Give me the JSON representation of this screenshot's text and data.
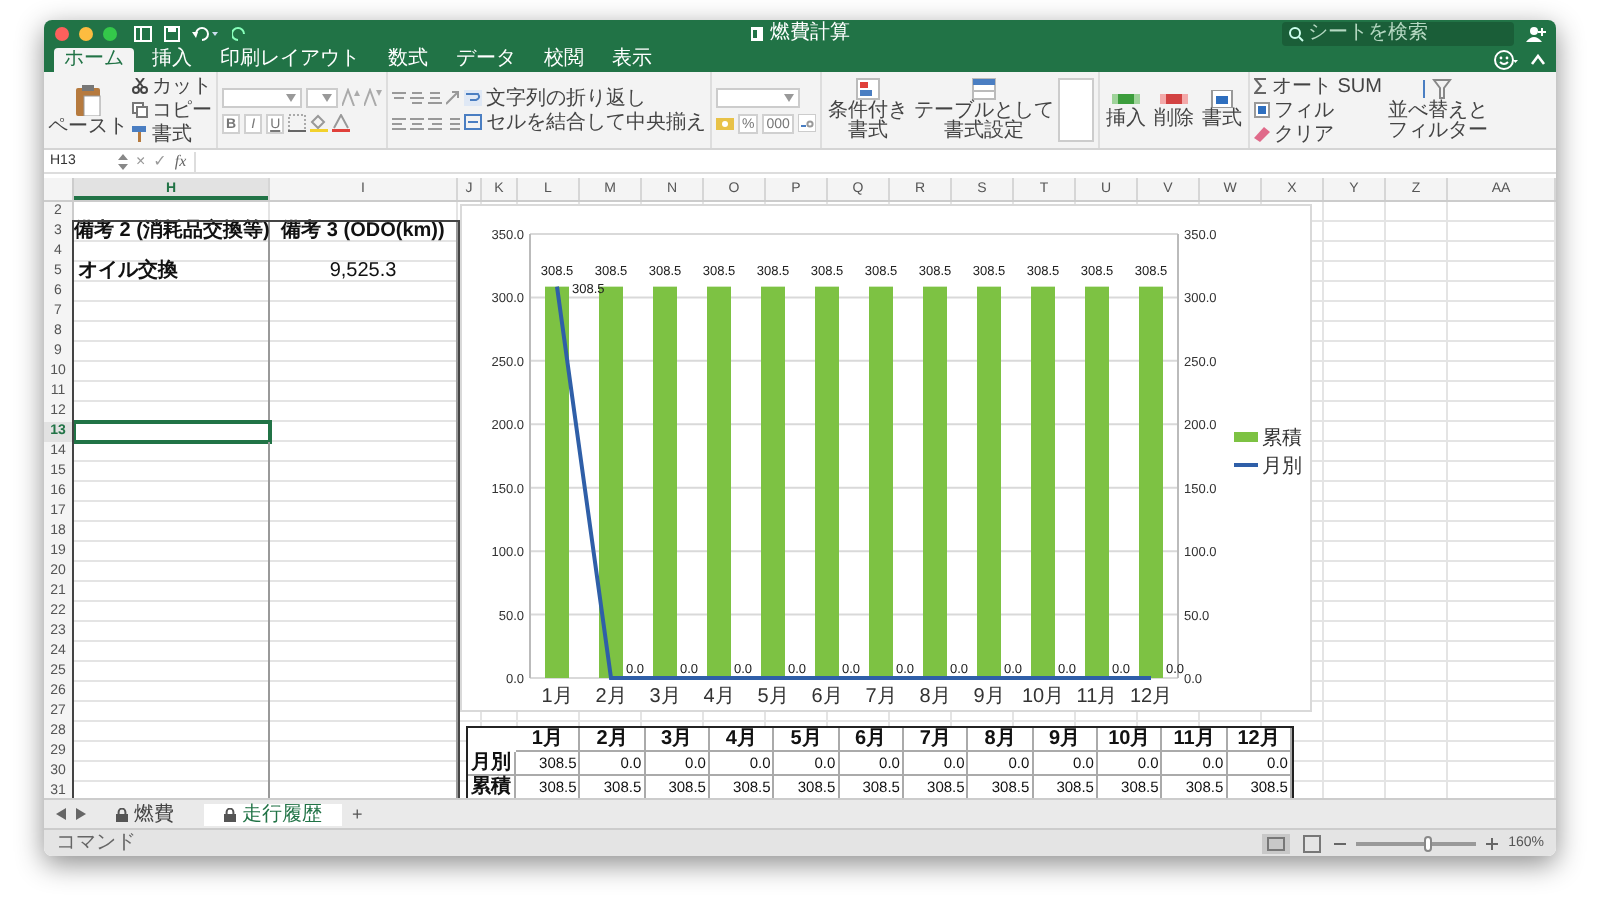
{
  "window": {
    "title": "燃費計算",
    "search": {
      "placeholder": "シートを検索"
    }
  },
  "ribbon": {
    "tabs": [
      {
        "label": "ホーム",
        "selected": true
      },
      {
        "label": "挿入",
        "selected": false
      },
      {
        "label": "印刷レイアウト",
        "selected": false
      },
      {
        "label": "数式",
        "selected": false
      },
      {
        "label": "データ",
        "selected": false
      },
      {
        "label": "校閲",
        "selected": false
      },
      {
        "label": "表示",
        "selected": false
      }
    ],
    "clipboard": {
      "paste": "ペースト",
      "cut": "カット",
      "copy": "コピー",
      "format_painter": "書式"
    },
    "font": {
      "bold": "B",
      "italic": "I",
      "underline": "U"
    },
    "alignment": {
      "wrap_text": "文字列の折り返し",
      "merge_center": "セルを結合して中央揃え"
    },
    "number": {
      "percent": "%",
      "thousands": "000"
    },
    "styles": {
      "conditional": "条件付き書式",
      "table": "テーブルとして書式設定"
    },
    "cells": {
      "insert": "挿入",
      "delete": "削除",
      "format": "書式"
    },
    "editing": {
      "autosum": "オート SUM",
      "fill": "フィル",
      "clear": "クリア",
      "sort_filter": "並べ替えとフィルター"
    }
  },
  "formula_bar": {
    "name_box": "H13",
    "cancel": "×",
    "enter": "✓",
    "function": "fx"
  },
  "sheet": {
    "columns": [
      {
        "label": "H",
        "selected": true
      },
      {
        "label": "I",
        "selected": false
      },
      {
        "label": "J",
        "selected": false
      },
      {
        "label": "K",
        "selected": false
      },
      {
        "label": "L",
        "selected": false
      },
      {
        "label": "M",
        "selected": false
      },
      {
        "label": "N",
        "selected": false
      },
      {
        "label": "O",
        "selected": false
      },
      {
        "label": "P",
        "selected": false
      },
      {
        "label": "Q",
        "selected": false
      },
      {
        "label": "R",
        "selected": false
      },
      {
        "label": "S",
        "selected": false
      },
      {
        "label": "T",
        "selected": false
      },
      {
        "label": "U",
        "selected": false
      },
      {
        "label": "V",
        "selected": false
      },
      {
        "label": "W",
        "selected": false
      },
      {
        "label": "X",
        "selected": false
      },
      {
        "label": "Y",
        "selected": false
      },
      {
        "label": "Z",
        "selected": false
      },
      {
        "label": "AA",
        "selected": false
      }
    ],
    "rows": [
      {
        "number": "2",
        "selected": false
      },
      {
        "number": "3",
        "selected": false,
        "cells": [
          {
            "text": "備考 2 (消耗品交換等)",
            "bold": true,
            "centered": true
          },
          {
            "text": "備考 3 (ODO(km))",
            "bold": true,
            "centered": true
          }
        ]
      },
      {
        "number": "4",
        "selected": false
      },
      {
        "number": "5",
        "selected": false,
        "cells": [
          {
            "text": "オイル交換",
            "bold": true,
            "centered": false
          },
          {
            "text": "9,525.3",
            "bold": false,
            "centered": true
          }
        ]
      },
      {
        "number": "6",
        "selected": false
      },
      {
        "number": "7",
        "selected": false
      },
      {
        "number": "8",
        "selected": false
      },
      {
        "number": "9",
        "selected": false
      },
      {
        "number": "10",
        "selected": false
      },
      {
        "number": "11",
        "selected": false
      },
      {
        "number": "12",
        "selected": false
      },
      {
        "number": "13",
        "selected": true
      },
      {
        "number": "14",
        "selected": false
      },
      {
        "number": "15",
        "selected": false
      },
      {
        "number": "16",
        "selected": false
      },
      {
        "number": "17",
        "selected": false
      },
      {
        "number": "18",
        "selected": false
      },
      {
        "number": "19",
        "selected": false
      },
      {
        "number": "20",
        "selected": false
      },
      {
        "number": "21",
        "selected": false
      },
      {
        "number": "22",
        "selected": false
      },
      {
        "number": "23",
        "selected": false
      },
      {
        "number": "24",
        "selected": false
      },
      {
        "number": "25",
        "selected": false
      },
      {
        "number": "26",
        "selected": false
      },
      {
        "number": "27",
        "selected": false
      },
      {
        "number": "28",
        "selected": false
      },
      {
        "number": "29",
        "selected": false
      },
      {
        "number": "30",
        "selected": false
      },
      {
        "number": "31",
        "selected": false
      }
    ]
  },
  "chart": {
    "chart_data": {
      "type": "bar",
      "categories": [
        "1月",
        "2月",
        "3月",
        "4月",
        "5月",
        "6月",
        "7月",
        "8月",
        "9月",
        "10月",
        "11月",
        "12月"
      ],
      "series": [
        {
          "name": "累積",
          "type": "bar",
          "color": "#7dc243",
          "values": [
            308.5,
            308.5,
            308.5,
            308.5,
            308.5,
            308.5,
            308.5,
            308.5,
            308.5,
            308.5,
            308.5,
            308.5
          ]
        },
        {
          "name": "月別",
          "type": "line",
          "color": "#2f5fa8",
          "values": [
            308.5,
            0,
            0,
            0,
            0,
            0,
            0,
            0,
            0,
            0,
            0,
            0
          ]
        }
      ],
      "ylim": [
        0,
        350
      ],
      "yticks": [
        {
          "value": 0,
          "label": "0.0"
        },
        {
          "value": 50,
          "label": "50.0"
        },
        {
          "value": 100,
          "label": "100.0"
        },
        {
          "value": 150,
          "label": "150.0"
        },
        {
          "value": 200,
          "label": "200.0"
        },
        {
          "value": 250,
          "label": "250.0"
        },
        {
          "value": 300,
          "label": "300.0"
        },
        {
          "value": 350,
          "label": "350.0"
        }
      ],
      "y2lim": [
        0,
        350
      ],
      "y2ticks": [
        {
          "value": 0,
          "label": "0.0"
        },
        {
          "value": 50,
          "label": "50.0"
        },
        {
          "value": 100,
          "label": "100.0"
        },
        {
          "value": 150,
          "label": "150.0"
        },
        {
          "value": 200,
          "label": "200.0"
        },
        {
          "value": 250,
          "label": "250.0"
        },
        {
          "value": 300,
          "label": "300.0"
        },
        {
          "value": 350,
          "label": "350.0"
        }
      ],
      "grid": true,
      "legend": "right",
      "value_labels": [
        [
          "308.5",
          "308.5",
          "308.5",
          "308.5",
          "308.5",
          "308.5",
          "308.5",
          "308.5",
          "308.5",
          "308.5",
          "308.5",
          "308.5"
        ],
        [
          "308.5",
          "0.0",
          "0.0",
          "0.0",
          "0.0",
          "0.0",
          "0.0",
          "0.0",
          "0.0",
          "0.0",
          "0.0",
          "0.0"
        ]
      ]
    }
  },
  "data_table": {
    "columns": [
      "1月",
      "2月",
      "3月",
      "4月",
      "5月",
      "6月",
      "7月",
      "8月",
      "9月",
      "10月",
      "11月",
      "12月"
    ],
    "rows": [
      {
        "label": "月別",
        "values": [
          "308.5",
          "0.0",
          "0.0",
          "0.0",
          "0.0",
          "0.0",
          "0.0",
          "0.0",
          "0.0",
          "0.0",
          "0.0",
          "0.0"
        ]
      },
      {
        "label": "累積",
        "values": [
          "308.5",
          "308.5",
          "308.5",
          "308.5",
          "308.5",
          "308.5",
          "308.5",
          "308.5",
          "308.5",
          "308.5",
          "308.5",
          "308.5"
        ]
      }
    ]
  },
  "sheet_tabs": {
    "tabs": [
      {
        "label": "燃費",
        "selected": false
      },
      {
        "label": "走行履歴",
        "selected": true
      }
    ],
    "add": "+"
  },
  "status_bar": {
    "mode": "コマンド",
    "zoom": {
      "level": 0.6,
      "reading": "160%"
    }
  }
}
